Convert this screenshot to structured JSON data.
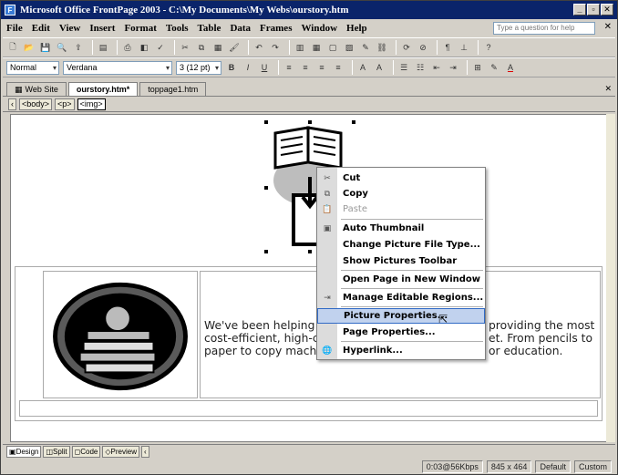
{
  "title_bar": {
    "title": "Microsoft Office FrontPage 2003 - C:\\My Documents\\My Webs\\ourstory.htm",
    "minimize": "_",
    "restore": "▫",
    "close": "✕"
  },
  "menu": {
    "items": [
      {
        "label": "File"
      },
      {
        "label": "Edit"
      },
      {
        "label": "View"
      },
      {
        "label": "Insert"
      },
      {
        "label": "Format"
      },
      {
        "label": "Tools"
      },
      {
        "label": "Table"
      },
      {
        "label": "Data"
      },
      {
        "label": "Frames"
      },
      {
        "label": "Window"
      },
      {
        "label": "Help"
      }
    ],
    "help_placeholder": "Type a question for help",
    "close_doc": "✕"
  },
  "formatting": {
    "style": "Normal",
    "font": "Verdana",
    "size": "3 (12 pt)"
  },
  "doc_tabs": {
    "web_site": "Web Site",
    "ourstory": "ourstory.htm*",
    "toppage": "toppage1.htm"
  },
  "tags": [
    "<body>",
    "<p>",
    "<img>"
  ],
  "page": {
    "body_text_lines": [
      "We've been helping",
      "cost-efficient, high-c",
      "paper to copy machi"
    ],
    "body_text_right": [
      "providing the most",
      "et. From pencils to",
      "or education."
    ]
  },
  "context_menu": {
    "items": [
      {
        "label": "Cut",
        "icon": "scissors-icon",
        "glyph": "✂"
      },
      {
        "label": "Copy",
        "icon": "copy-icon",
        "glyph": "⧉"
      },
      {
        "label": "Paste",
        "icon": "paste-icon",
        "glyph": "📋",
        "disabled": true
      },
      {
        "label": "Auto Thumbnail",
        "icon": "thumbnail-icon",
        "glyph": "▣"
      },
      {
        "label": "Change Picture File Type...",
        "icon": "",
        "glyph": ""
      },
      {
        "label": "Show Pictures Toolbar",
        "icon": "",
        "glyph": ""
      },
      {
        "label": "Open Page in New Window",
        "icon": "",
        "glyph": ""
      },
      {
        "label": "Manage Editable Regions...",
        "icon": "editable-regions-icon",
        "glyph": "⇥"
      },
      {
        "label": "Picture Properties...",
        "icon": "",
        "glyph": "",
        "highlighted": true
      },
      {
        "label": "Page Properties...",
        "icon": "",
        "glyph": ""
      },
      {
        "label": "Hyperlink...",
        "icon": "hyperlink-icon",
        "glyph": "🌐"
      }
    ]
  },
  "view_bar": {
    "design": "Design",
    "split": "Split",
    "code": "Code",
    "preview": "Preview"
  },
  "status": {
    "speed": "0:03@56Kbps",
    "dimensions": "845 x 464",
    "mode": "Default",
    "custom": "Custom"
  }
}
